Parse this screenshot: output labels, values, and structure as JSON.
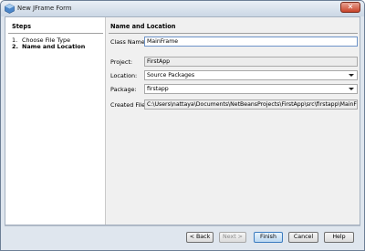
{
  "window": {
    "title": "New JFrame Form"
  },
  "steps": {
    "title": "Steps",
    "items": [
      {
        "num": "1.",
        "label": "Choose File Type"
      },
      {
        "num": "2.",
        "label": "Name and Location"
      }
    ]
  },
  "form": {
    "title": "Name and Location",
    "class_name_label": "Class Name:",
    "class_name_value": "MainFrame",
    "project_label": "Project:",
    "project_value": "FirstApp",
    "location_label": "Location:",
    "location_value": "Source Packages",
    "package_label": "Package:",
    "package_value": "firstapp",
    "created_file_label": "Created File:",
    "created_file_value": "C:\\Users\\nattaya\\Documents\\NetBeansProjects\\FirstApp\\src\\firstapp\\MainFrame.java"
  },
  "buttons": {
    "back": "< Back",
    "next": "Next >",
    "finish": "Finish",
    "cancel": "Cancel",
    "help": "Help"
  },
  "icons": {
    "app": "netbeans-cube-icon",
    "close": "close-icon"
  }
}
